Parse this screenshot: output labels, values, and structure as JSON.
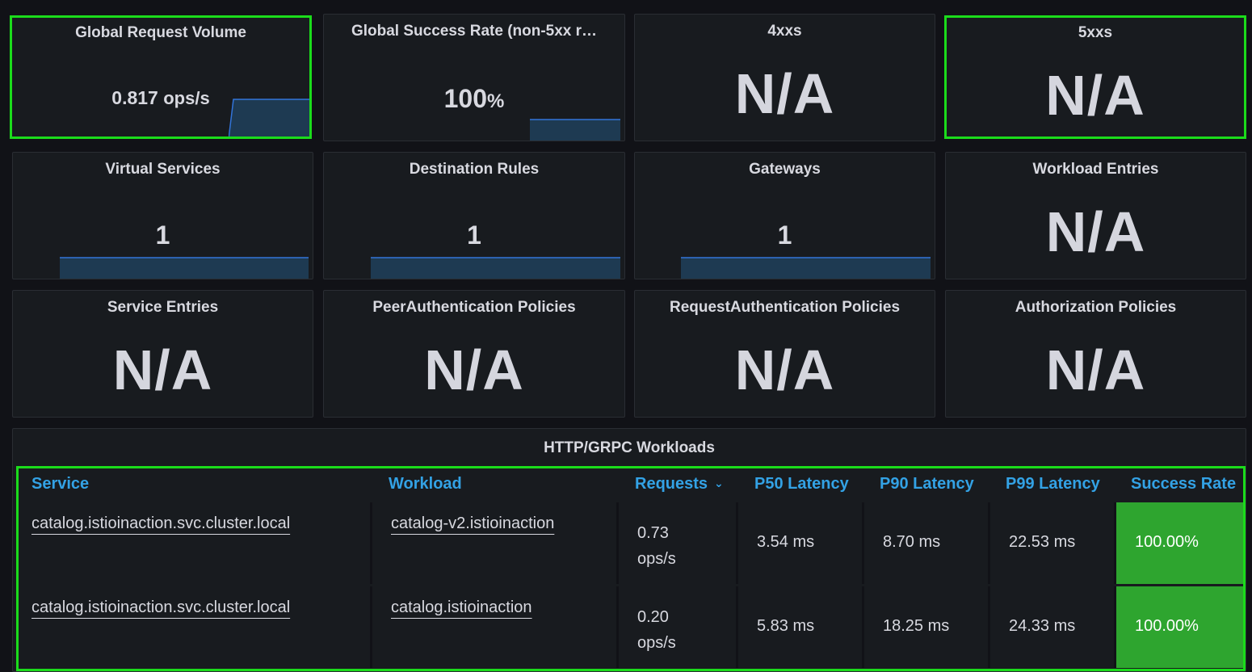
{
  "stats": {
    "global_request_volume": {
      "title": "Global Request Volume",
      "value": "0.817",
      "unit": "ops/s"
    },
    "global_success_rate": {
      "title": "Global Success Rate (non-5xx r…",
      "value": "100",
      "unit": "%"
    },
    "4xxs": {
      "title": "4xxs",
      "value": "N/A"
    },
    "5xxs": {
      "title": "5xxs",
      "value": "N/A"
    },
    "virtual_services": {
      "title": "Virtual Services",
      "value": "1"
    },
    "destination_rules": {
      "title": "Destination Rules",
      "value": "1"
    },
    "gateways": {
      "title": "Gateways",
      "value": "1"
    },
    "workload_entries": {
      "title": "Workload Entries",
      "value": "N/A"
    },
    "service_entries": {
      "title": "Service Entries",
      "value": "N/A"
    },
    "peer_auth": {
      "title": "PeerAuthentication Policies",
      "value": "N/A"
    },
    "request_auth": {
      "title": "RequestAuthentication Policies",
      "value": "N/A"
    },
    "authz": {
      "title": "Authorization Policies",
      "value": "N/A"
    }
  },
  "workloads": {
    "title": "HTTP/GRPC Workloads",
    "columns": [
      "Service",
      "Workload",
      "Requests",
      "P50 Latency",
      "P90 Latency",
      "P99 Latency",
      "Success Rate"
    ],
    "sort_indicator": "⌄",
    "rows": [
      {
        "service": "catalog.istioinaction.svc.cluster.local",
        "workload": "catalog-v2.istioinaction",
        "requests_value": "0.73",
        "requests_unit": "ops/s",
        "p50": "3.54 ms",
        "p90": "8.70 ms",
        "p99": "22.53 ms",
        "success": "100.00%"
      },
      {
        "service": "catalog.istioinaction.svc.cluster.local",
        "workload": "catalog.istioinaction",
        "requests_value": "0.20",
        "requests_unit": "ops/s",
        "p50": "5.83 ms",
        "p90": "18.25 ms",
        "p99": "24.33 ms",
        "success": "100.00%"
      }
    ]
  },
  "colors": {
    "background": "#111217",
    "panel": "#181b1f",
    "highlight": "#1bdc1b",
    "header_text": "#33a2e5",
    "success": "#2ea52f",
    "spark_line": "#3274d9",
    "spark_fill": "#1e3a52"
  }
}
